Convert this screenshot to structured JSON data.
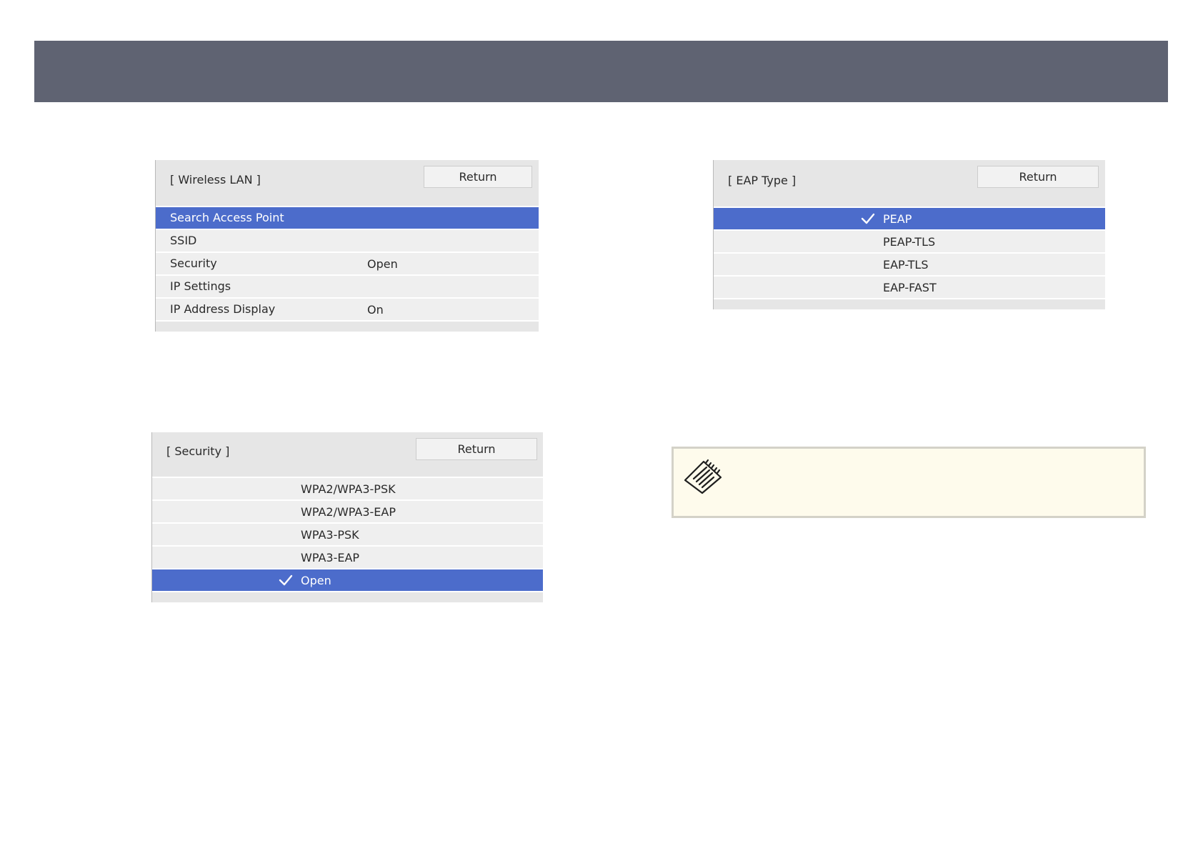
{
  "wireless_lan": {
    "title": "[ Wireless LAN ]",
    "return_label": "Return",
    "rows": [
      {
        "label": "Search Access Point",
        "value": ""
      },
      {
        "label": "SSID",
        "value": ""
      },
      {
        "label": "Security",
        "value": "Open"
      },
      {
        "label": "IP Settings",
        "value": ""
      },
      {
        "label": "IP Address Display",
        "value": "On"
      }
    ],
    "selected": "Search Access Point"
  },
  "security": {
    "title": "[ Security ]",
    "return_label": "Return",
    "options": [
      "WPA2/WPA3-PSK",
      "WPA2/WPA3-EAP",
      "WPA3-PSK",
      "WPA3-EAP",
      "Open"
    ],
    "selected": "Open"
  },
  "eap_type": {
    "title": "[ EAP Type ]",
    "return_label": "Return",
    "options": [
      "PEAP",
      "PEAP-TLS",
      "EAP-TLS",
      "EAP-FAST"
    ],
    "selected": "PEAP"
  },
  "note": {
    "icon": "note-pad-icon"
  },
  "colors": {
    "header_bar": "#5f6372",
    "selection": "#4c6ccb",
    "panel_bg": "#e6e6e6",
    "note_bg": "#fefbec"
  }
}
